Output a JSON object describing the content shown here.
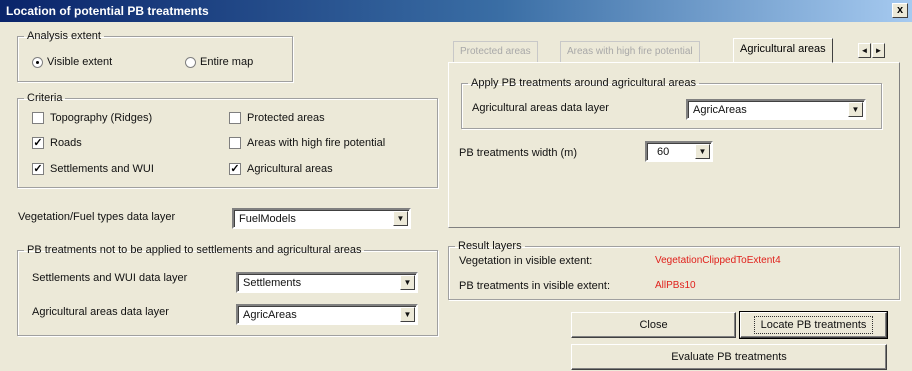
{
  "window": {
    "title": "Location of potential PB treatments",
    "close_glyph": "x"
  },
  "analysis_extent": {
    "legend": "Analysis extent",
    "options": [
      {
        "label": "Visible extent",
        "selected": true
      },
      {
        "label": "Entire map",
        "selected": false
      }
    ]
  },
  "criteria": {
    "legend": "Criteria",
    "items": [
      {
        "label": "Topography (Ridges)",
        "checked": false
      },
      {
        "label": "Protected areas",
        "checked": false
      },
      {
        "label": "Roads",
        "checked": true
      },
      {
        "label": "Areas with high fire potential",
        "checked": false
      },
      {
        "label": "Settlements and WUI",
        "checked": true
      },
      {
        "label": "Agricultural areas",
        "checked": true
      }
    ]
  },
  "vegetation": {
    "label": "Vegetation/Fuel types data layer",
    "value": "FuelModels"
  },
  "exclusion": {
    "legend": "PB treatments not to be applied to settlements and agricultural areas",
    "settlements_label": "Settlements and WUI data layer",
    "settlements_value": "Settlements",
    "agri_label": "Agricultural areas data layer",
    "agri_value": "AgricAreas"
  },
  "tabs": [
    {
      "label": "Protected areas",
      "active": false
    },
    {
      "label": "Areas with high fire potential",
      "active": false
    },
    {
      "label": "Agricultural areas",
      "active": true
    }
  ],
  "agri_tab": {
    "legend": "Apply PB treatments around agricultural areas",
    "layer_label": "Agricultural areas data layer",
    "layer_value": "AgricAreas",
    "width_label": "PB treatments width (m)",
    "width_value": "60"
  },
  "results": {
    "legend": "Result layers",
    "veg_label": "Vegetation in visible extent:",
    "veg_value": "VegetationClippedToExtent4",
    "pb_label": "PB treatments in visible extent:",
    "pb_value": "AllPBs10"
  },
  "buttons": {
    "close": "Close",
    "locate": "Locate PB treatments",
    "evaluate": "Evaluate PB treatments"
  },
  "icons": {
    "dropdown": "▼",
    "tab_left": "◄",
    "tab_right": "►",
    "check": "✓"
  },
  "colors": {
    "title_start": "#0a246a",
    "result_value": "#e0201b"
  }
}
